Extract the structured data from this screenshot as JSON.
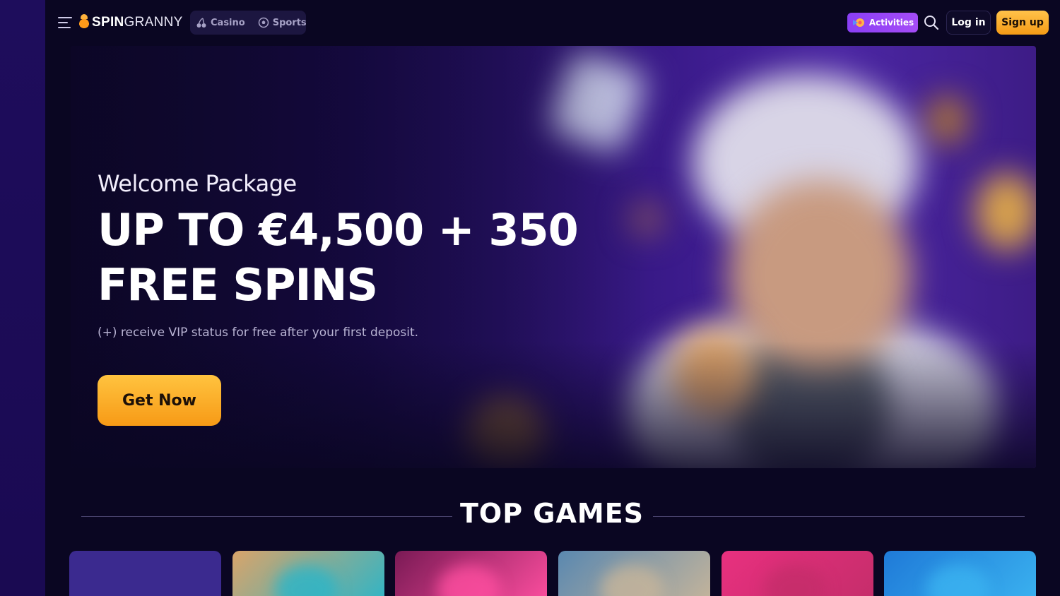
{
  "brand": {
    "logo_prefix": "SPIN",
    "logo_suffix": "GRANNY"
  },
  "nav": {
    "items": [
      {
        "label": "Casino",
        "icon": "cherry-icon"
      },
      {
        "label": "Sports",
        "icon": "soccer-ball-icon"
      }
    ]
  },
  "header": {
    "activities_label": "Activities",
    "login_label": "Log in",
    "signup_label": "Sign up"
  },
  "hero": {
    "kicker": "Welcome Package",
    "title_line1": "UP TO €4,500 + 350",
    "title_line2": "FREE SPINS",
    "subtitle": "(+) receive VIP status for free after your first deposit.",
    "cta_label": "Get Now"
  },
  "top_games": {
    "title": "TOP GAMES",
    "cards": [
      {
        "colors": [
          "#3b2a8f",
          "#3b2a8f"
        ]
      },
      {
        "colors": [
          "#d9a46a",
          "#2bb5c8"
        ]
      },
      {
        "colors": [
          "#7a1a55",
          "#ff4fa0"
        ]
      },
      {
        "colors": [
          "#5a88b0",
          "#c7b59a"
        ]
      },
      {
        "colors": [
          "#e8307f",
          "#c42d6a"
        ]
      },
      {
        "colors": [
          "#1f7ad8",
          "#3bb3f0"
        ]
      }
    ]
  },
  "colors": {
    "accent_orange": "#f7a21b",
    "accent_purple": "#9a45f6",
    "background": "#0a0622"
  }
}
